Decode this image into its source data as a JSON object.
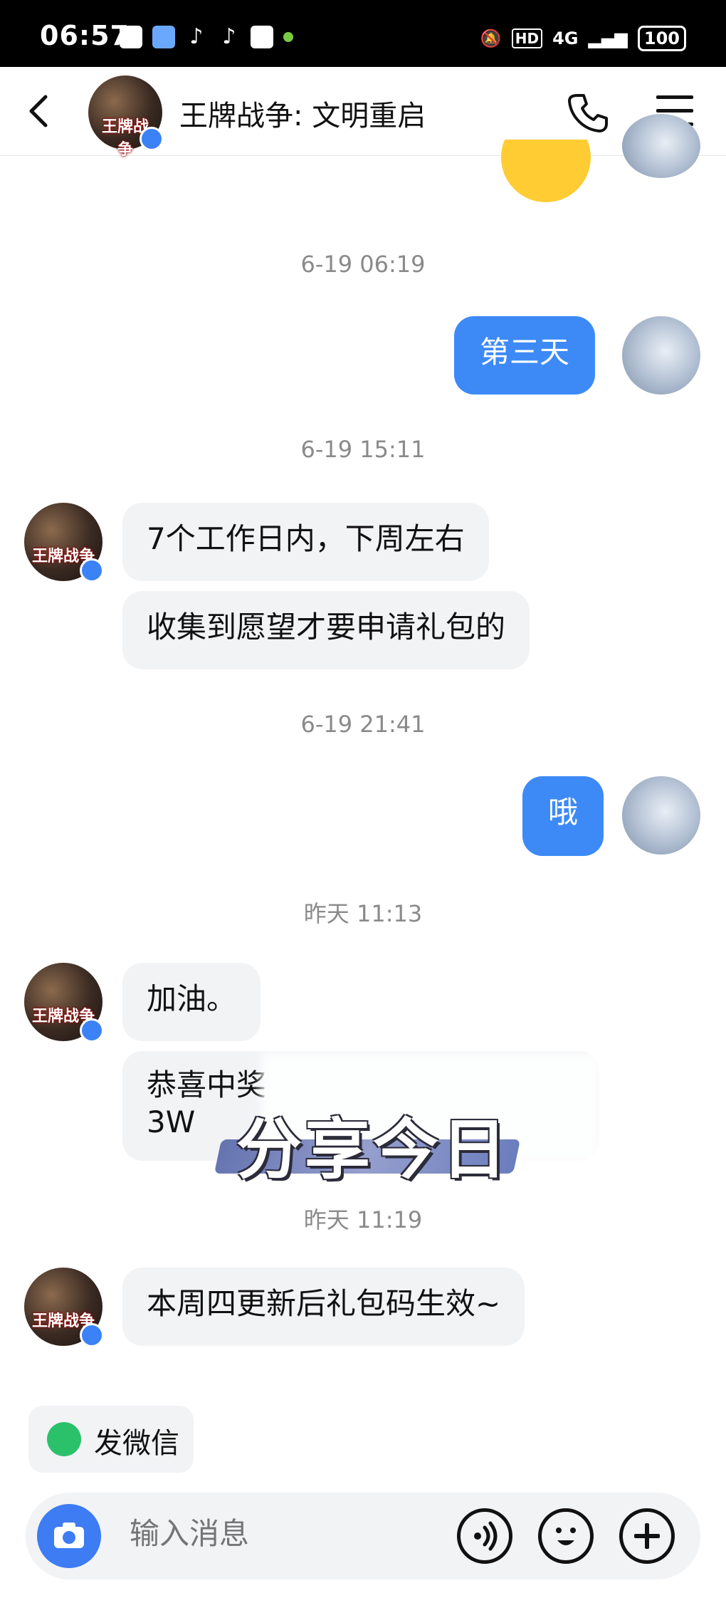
{
  "status_bar": {
    "time": "06:57",
    "network": "4G",
    "battery": "100"
  },
  "header": {
    "title": "王牌战争: 文明重启",
    "game_logo_text": "王牌战争"
  },
  "messages": {
    "ts1": "6-19 06:19",
    "m1": "第三天",
    "ts2": "6-19 15:11",
    "m2": "7个工作日内，下周左右",
    "m3": "收集到愿望才要申请礼包的",
    "ts3": "6-19 21:41",
    "m4": "哦",
    "ts4": "昨天 11:13",
    "m5": "加油。",
    "m6_line1": "恭喜中奖",
    "m6_line2": "3W",
    "ts5": "昨天 11:19",
    "m7": "本周四更新后礼包码生效~"
  },
  "overlay": {
    "text": "分享今日"
  },
  "quick_action": {
    "wechat_label": "发微信"
  },
  "input": {
    "placeholder": "输入消息"
  },
  "colors": {
    "accent": "#3d8af7",
    "wechat": "#2bc16b",
    "camera": "#3d7cf2"
  }
}
